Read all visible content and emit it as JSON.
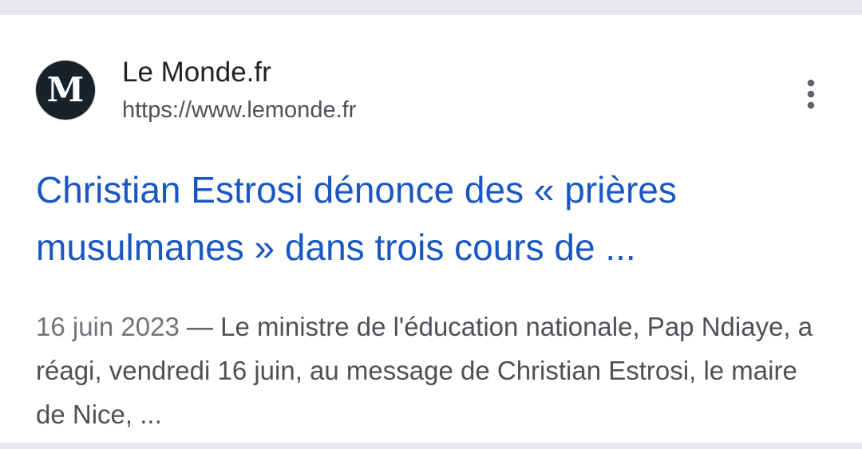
{
  "result": {
    "favicon": {
      "icon": "le-monde-logo-icon",
      "glyph": "M",
      "background": "#17222a",
      "glyph_color": "#ffffff"
    },
    "site_name": "Le Monde.fr",
    "url": "https://www.lemonde.fr",
    "menu_icon": "more-vertical-icon",
    "title_line_1": "Christian Estrosi dénonce des « prières",
    "title_line_2": "musulmanes » dans trois cours de ...",
    "date": "16 juin 2023",
    "separator": " — ",
    "snippet": "Le ministre de l'éducation nationale, Pap Ndiaye, a réagi, vendredi 16 juin, au message de Christian Estrosi, le maire de Nice, ..."
  },
  "colors": {
    "title_link": "#1a57c1",
    "snippet_text": "#4d5156",
    "page_background": "#e8e9ec",
    "card_background": "#ffffff"
  }
}
